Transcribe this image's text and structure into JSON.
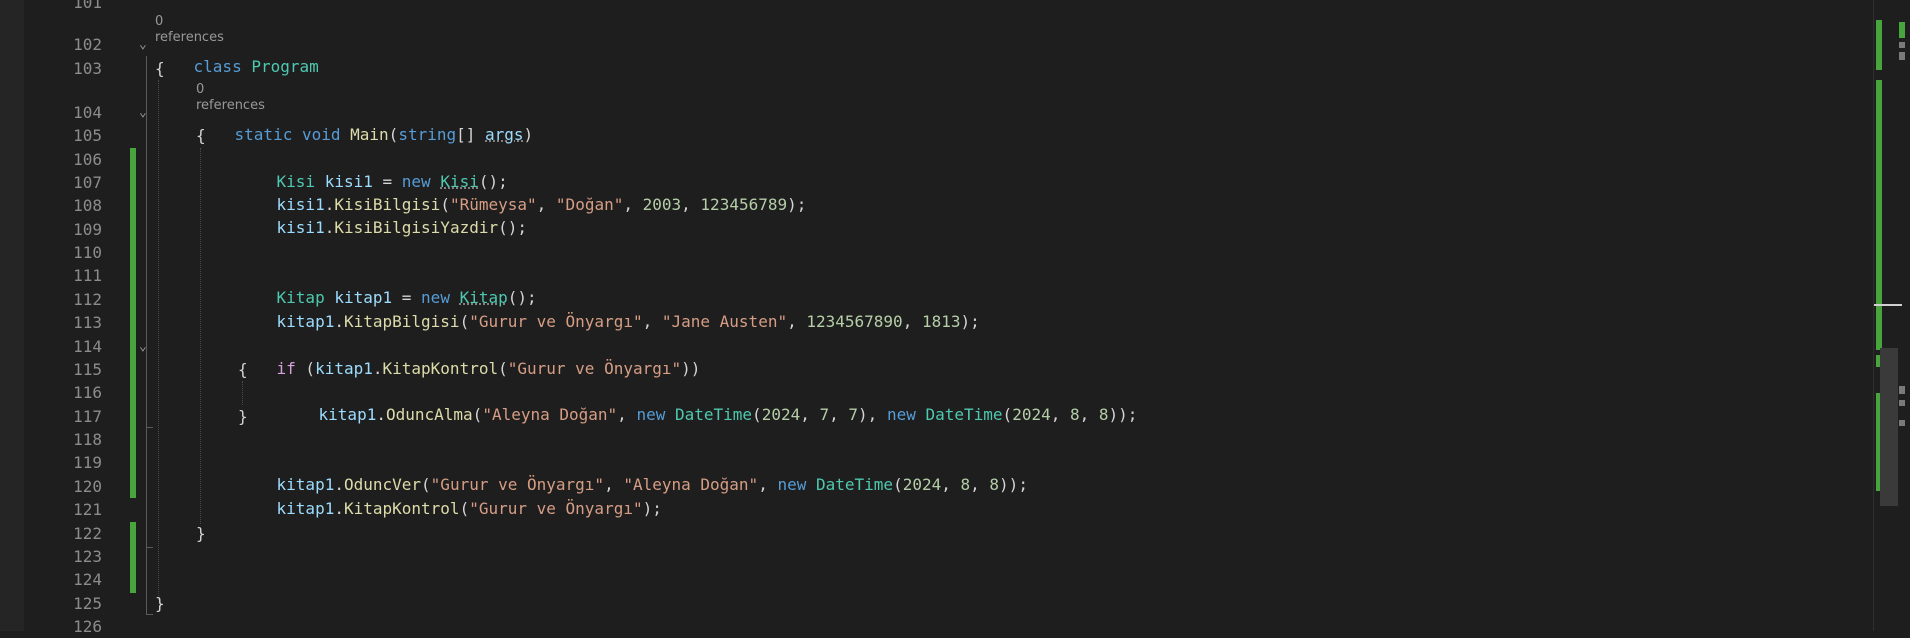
{
  "editor": {
    "codelens": {
      "class_refs": "0 references",
      "method_refs": "0 references"
    },
    "line_numbers": [
      "101",
      "102",
      "103",
      "104",
      "105",
      "106",
      "107",
      "108",
      "109",
      "110",
      "111",
      "112",
      "113",
      "114",
      "115",
      "116",
      "117",
      "118",
      "119",
      "120",
      "121",
      "122",
      "123",
      "124",
      "125",
      "126"
    ],
    "code": {
      "l102": {
        "kw": "class",
        "name": "Program"
      },
      "l103": {
        "brace": "{"
      },
      "l104": {
        "kw1": "static",
        "kw2": "void",
        "method": "Main",
        "p1": "(",
        "type": "string",
        "p2": "[] ",
        "param": "args",
        "p3": ")"
      },
      "l105": {
        "brace": "{"
      },
      "l106": {
        "type": "Kisi",
        "var": "kisi1",
        "eq": " = ",
        "kw": "new",
        "ctor": "Kisi",
        "end": "();"
      },
      "l107": {
        "obj": "kisi1",
        "dot": ".",
        "method": "KisiBilgisi",
        "p1": "(",
        "s1": "\"Rümeysa\"",
        "c1": ", ",
        "s2": "\"Doğan\"",
        "c2": ", ",
        "n1": "2003",
        "c3": ", ",
        "n2": "123456789",
        "end": ");"
      },
      "l108": {
        "obj": "kisi1",
        "dot": ".",
        "method": "KisiBilgisiYazdir",
        "end": "();"
      },
      "l111": {
        "type": "Kitap",
        "var": "kitap1",
        "eq": " = ",
        "kw": "new",
        "ctor": "Kitap",
        "end": "();"
      },
      "l112": {
        "obj": "kitap1",
        "dot": ".",
        "method": "KitapBilgisi",
        "p1": "(",
        "s1": "\"Gurur ve Önyargı\"",
        "c1": ", ",
        "s2": "\"Jane Austen\"",
        "c2": ", ",
        "n1": "1234567890",
        "c3": ", ",
        "n2": "1813",
        "end": ");"
      },
      "l114": {
        "kw": "if",
        "p1": " (",
        "obj": "kitap1",
        "dot": ".",
        "method": "KitapKontrol",
        "p2": "(",
        "s1": "\"Gurur ve Önyargı\"",
        "end": "))"
      },
      "l115": {
        "brace": "{"
      },
      "l116": {
        "obj": "kitap1",
        "dot": ".",
        "method": "OduncAlma",
        "p1": "(",
        "s1": "\"Aleyna Doğan\"",
        "c1": ", ",
        "kw1": "new",
        "t1": "DateTime",
        "p2": "(",
        "n1": "2024",
        "c2": ", ",
        "n2": "7",
        "c3": ", ",
        "n3": "7",
        "p3": "), ",
        "kw2": "new",
        "t2": "DateTime",
        "p4": "(",
        "n4": "2024",
        "c4": ", ",
        "n5": "8",
        "c5": ", ",
        "n6": "8",
        "end": "));"
      },
      "l117": {
        "brace": "}"
      },
      "l119": {
        "obj": "kitap1",
        "dot": ".",
        "method": "OduncVer",
        "p1": "(",
        "s1": "\"Gurur ve Önyargı\"",
        "c1": ", ",
        "s2": "\"Aleyna Doğan\"",
        "c2": ", ",
        "kw": "new",
        "t": "DateTime",
        "p2": "(",
        "n1": "2024",
        "c3": ", ",
        "n2": "8",
        "c4": ", ",
        "n3": "8",
        "end": "));"
      },
      "l120": {
        "obj": "kitap1",
        "dot": ".",
        "method": "KitapKontrol",
        "p1": "(",
        "s1": "\"Gurur ve Önyargı\"",
        "end": ");"
      },
      "l122": {
        "brace": "}"
      },
      "l125": {
        "brace": "}"
      }
    },
    "fold_glyph": "⌄"
  },
  "colors": {
    "background": "#1e1e1e",
    "keyword": "#569cd6",
    "control_keyword": "#d8a0df",
    "type": "#4ec9b0",
    "method": "#dcdcaa",
    "variable": "#9cdcfe",
    "string": "#d69d85",
    "number": "#b5cea8",
    "change_marker": "#48a43d"
  }
}
